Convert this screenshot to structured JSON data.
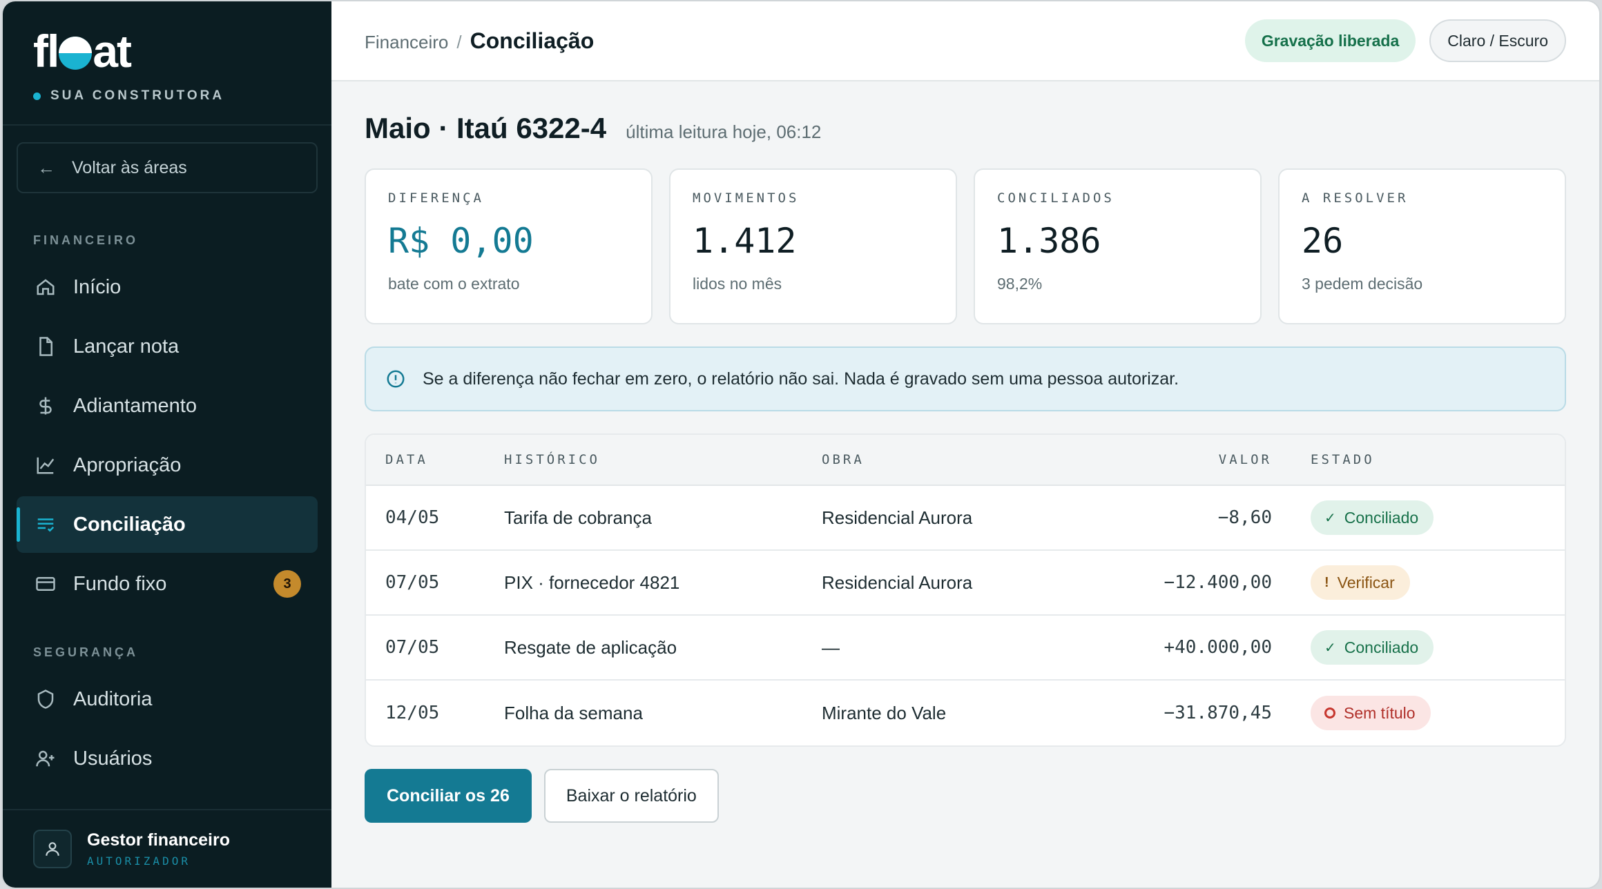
{
  "brand": {
    "logo_left": "fl",
    "logo_right": "at",
    "company": "SUA CONSTRUTORA",
    "accent": "#1ab3d1"
  },
  "sidebar": {
    "back_label": "Voltar às áreas",
    "section_financeiro": "FINANCEIRO",
    "section_seguranca": "SEGURANÇA",
    "items": [
      {
        "label": "Início",
        "icon": "home-icon"
      },
      {
        "label": "Lançar nota",
        "icon": "file-icon"
      },
      {
        "label": "Adiantamento",
        "icon": "dollar-icon"
      },
      {
        "label": "Apropriação",
        "icon": "chart-icon"
      },
      {
        "label": "Conciliação",
        "icon": "reconcile-icon",
        "active": true
      },
      {
        "label": "Fundo fixo",
        "icon": "card-icon",
        "badge": "3"
      }
    ],
    "security_items": [
      {
        "label": "Auditoria",
        "icon": "shield-icon"
      },
      {
        "label": "Usuários",
        "icon": "user-add-icon"
      }
    ],
    "user": {
      "name": "Gestor financeiro",
      "role": "AUTORIZADOR"
    }
  },
  "header": {
    "breadcrumb_parent": "Financeiro",
    "breadcrumb_sep": "/",
    "breadcrumb_current": "Conciliação",
    "status_pill": "Gravação liberada",
    "theme_toggle": "Claro / Escuro"
  },
  "page": {
    "title": "Maio · Itaú 6322-4",
    "subtitle": "última leitura hoje, 06:12"
  },
  "stats": [
    {
      "label": "DIFERENÇA",
      "value": "R$ 0,00",
      "note": "bate com o extrato"
    },
    {
      "label": "MOVIMENTOS",
      "value": "1.412",
      "note": "lidos no mês"
    },
    {
      "label": "CONCILIADOS",
      "value": "1.386",
      "note": "98,2%"
    },
    {
      "label": "A RESOLVER",
      "value": "26",
      "note": "3 pedem decisão"
    }
  ],
  "notice": "Se a diferença não fechar em zero, o relatório não sai. Nada é gravado sem uma pessoa autorizar.",
  "table": {
    "headers": [
      "DATA",
      "HISTÓRICO",
      "OBRA",
      "VALOR",
      "ESTADO"
    ],
    "rows": [
      {
        "date": "04/05",
        "history": "Tarifa de cobrança",
        "site": "Residencial Aurora",
        "value": "−8,60",
        "status": "Conciliado",
        "status_symbol": "✓"
      },
      {
        "date": "07/05",
        "history": "PIX · fornecedor 4821",
        "site": "Residencial Aurora",
        "value": "−12.400,00",
        "status": "Verificar",
        "status_symbol": "!"
      },
      {
        "date": "07/05",
        "history": "Resgate de aplicação",
        "site": "—",
        "value": "+40.000,00",
        "status": "Conciliado",
        "status_symbol": "✓"
      },
      {
        "date": "12/05",
        "history": "Folha da semana",
        "site": "Mirante do Vale",
        "value": "−31.870,45",
        "status": "Sem título",
        "status_symbol": ""
      }
    ]
  },
  "actions": {
    "primary": "Conciliar os 26",
    "secondary": "Baixar o relatório"
  }
}
